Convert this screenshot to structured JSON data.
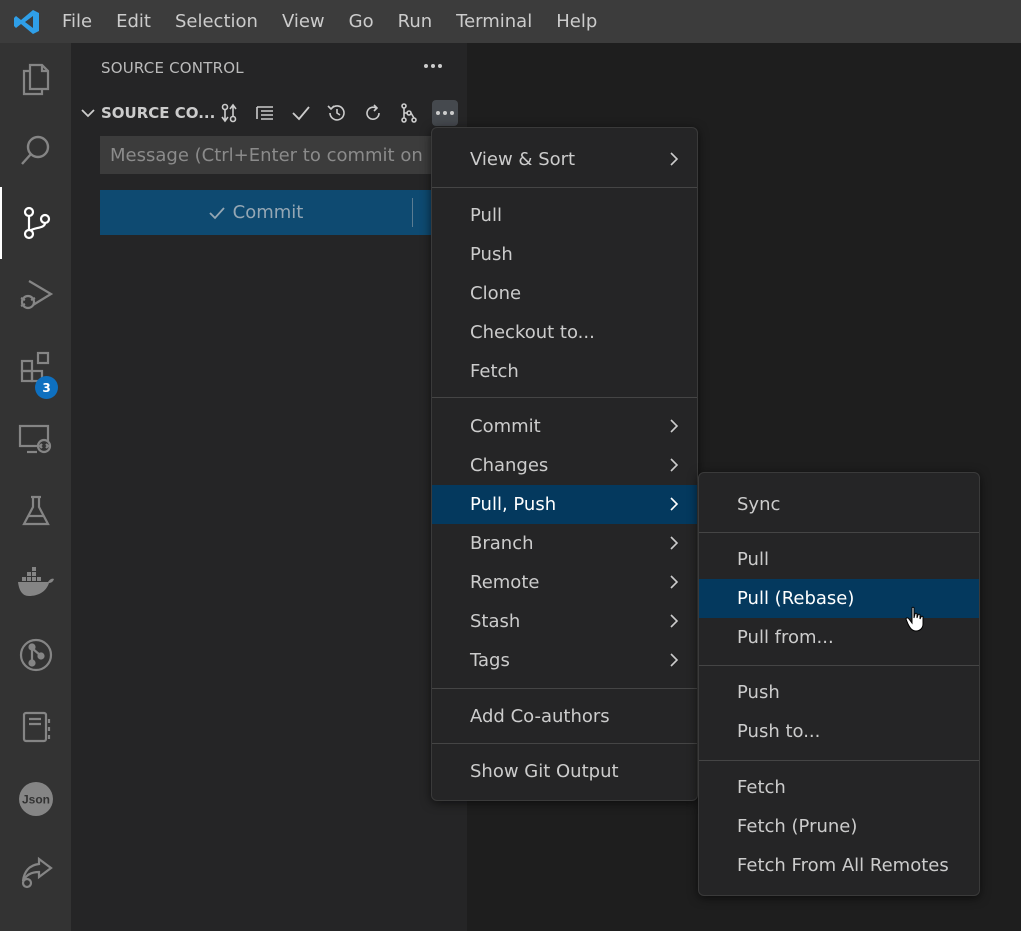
{
  "menubar": {
    "items": [
      "File",
      "Edit",
      "Selection",
      "View",
      "Go",
      "Run",
      "Terminal",
      "Help"
    ]
  },
  "activitybar": {
    "extensions_badge": "3"
  },
  "sidebar": {
    "header": "SOURCE CONTROL",
    "section_title": "SOURCE CO...",
    "message_placeholder": "Message (Ctrl+Enter to commit on 'e...",
    "commit_label": "Commit"
  },
  "context_menu": {
    "items": [
      "View & Sort",
      "Pull",
      "Push",
      "Clone",
      "Checkout to...",
      "Fetch",
      "Commit",
      "Changes",
      "Pull, Push",
      "Branch",
      "Remote",
      "Stash",
      "Tags",
      "Add Co-authors",
      "Show Git Output"
    ]
  },
  "submenu": {
    "items": [
      "Sync",
      "Pull",
      "Pull (Rebase)",
      "Pull from...",
      "Push",
      "Push to...",
      "Fetch",
      "Fetch (Prune)",
      "Fetch From All Remotes"
    ]
  },
  "colors": {
    "accent_selected": "#04395e",
    "badge": "#0e70c0",
    "commit_button": "#0e4a71",
    "logo": "#2f9fe8"
  },
  "icons": {
    "activitybar": [
      "files-icon",
      "search-icon",
      "source-control-icon",
      "run-debug-icon",
      "extensions-icon",
      "remote-explorer-icon",
      "testing-icon",
      "docker-icon",
      "git-graph-icon",
      "notebook-icon",
      "json-icon",
      "live-share-icon"
    ]
  }
}
